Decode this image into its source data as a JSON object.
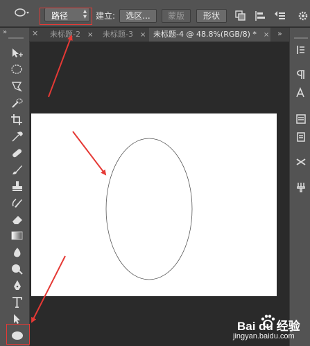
{
  "options_bar": {
    "mode_value": "路径",
    "build_label": "建立:",
    "selection_button": "选区...",
    "mask_button": "蒙版",
    "shape_button": "形状"
  },
  "tabs": [
    {
      "label": "未标题-2",
      "close": "×",
      "active": false
    },
    {
      "label": "未标题-3",
      "close": "×",
      "active": false
    },
    {
      "label": "未标题-4 @ 48.8%(RGB/8) *",
      "close": "×",
      "active": true
    }
  ],
  "panel_toggle_left": "»",
  "panel_toggle_right": "»",
  "watermark": {
    "brand": "Bai du 经验",
    "url": "jingyan.baidu.com"
  },
  "colors": {
    "annotation": "#e53935",
    "ui_panel": "#535353",
    "workspace": "#2a2a2a",
    "canvas": "#ffffff"
  }
}
